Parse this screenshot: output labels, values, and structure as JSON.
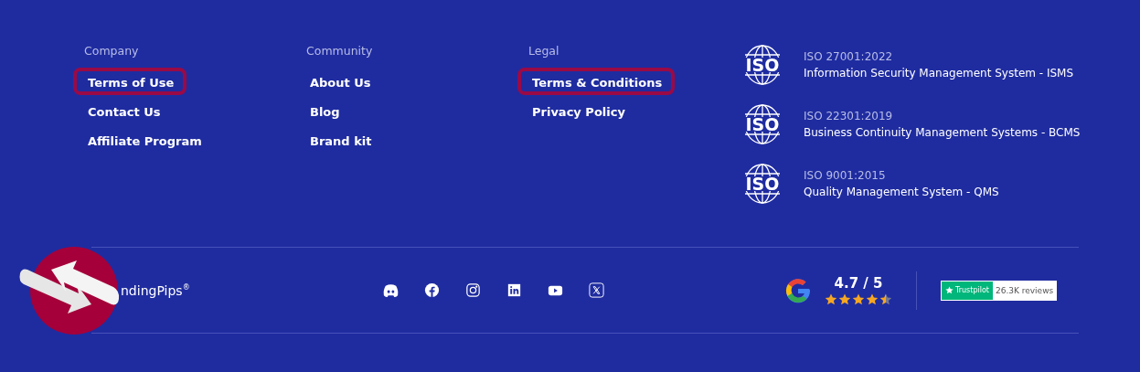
{
  "columns": [
    {
      "heading": "Company",
      "links": [
        {
          "label": "Terms of Use",
          "highlighted": true
        },
        {
          "label": "Contact Us",
          "highlighted": false
        },
        {
          "label": "Affiliate Program",
          "highlighted": false
        }
      ]
    },
    {
      "heading": "Community",
      "links": [
        {
          "label": "About Us",
          "highlighted": false
        },
        {
          "label": "Blog",
          "highlighted": false
        },
        {
          "label": "Brand kit",
          "highlighted": false
        }
      ]
    },
    {
      "heading": "Legal",
      "links": [
        {
          "label": "Terms & Conditions",
          "highlighted": true
        },
        {
          "label": "Privacy Policy",
          "highlighted": false
        }
      ]
    }
  ],
  "certifications": [
    {
      "logo_text": "ISO",
      "code": "ISO 27001:2022",
      "name": "Information Security Management System - ISMS"
    },
    {
      "logo_text": "ISO",
      "code": "ISO 22301:2019",
      "name": "Business Continuity Management Systems - BCMS"
    },
    {
      "logo_text": "ISO",
      "code": "ISO 9001:2015",
      "name": "Quality Management System - QMS"
    }
  ],
  "brand": {
    "name": "ndingPips",
    "mark": "®"
  },
  "social": [
    {
      "kind": "discord"
    },
    {
      "kind": "facebook"
    },
    {
      "kind": "instagram"
    },
    {
      "kind": "linkedin"
    },
    {
      "kind": "youtube"
    },
    {
      "kind": "x"
    }
  ],
  "google_rating": {
    "score": "4.7 / 5",
    "stars": 4.5
  },
  "trustpilot": {
    "label": "Trustpilot",
    "reviews": "26.3K reviews"
  }
}
